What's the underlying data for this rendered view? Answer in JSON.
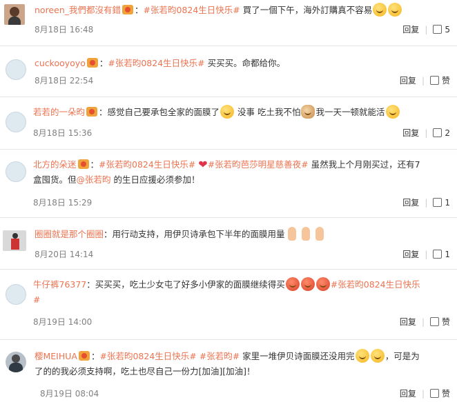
{
  "comments": [
    {
      "user": "noreen_我們都沒有錯",
      "topic": "#张若昀0824生日快乐#",
      "text": " 買了一個下午，海外訂購真不容易",
      "time": "8月18日 16:48",
      "reply": "回复",
      "likes": "5"
    },
    {
      "user": "cuckooyoyo",
      "topic": "#张若昀0824生日快乐#",
      "text": " 买买买。命都给你。",
      "time": "8月18日 22:54",
      "reply": "回复",
      "likes": "赞"
    },
    {
      "user": "若若的一朵昀",
      "text1": "：感觉自己要承包全家的面膜了",
      "text2": " 没事 吃土我不怕",
      "text3": "我一天一顿就能活",
      "time": "8月18日 15:36",
      "reply": "回复",
      "likes": "2"
    },
    {
      "user": "北方的朵迷",
      "topic": "#张若昀0824生日快乐#",
      "topic2": "#张若昀芭莎明星慈善夜#",
      "text1": " 虽然我上个月刚买过，还有7",
      "text2": "盒囤货。但",
      "mention": "@张若昀",
      "text3": " 的生日应援必须参加！",
      "time": "8月18日 15:29",
      "reply": "回复",
      "likes": "1"
    },
    {
      "user": "圈圈就是那个圈圈",
      "text": "：用行动支持，用伊贝诗承包下半年的面膜用量",
      "time": "8月20日 14:14",
      "reply": "回复",
      "likes": "1"
    },
    {
      "user": "牛仔裤76377",
      "text": "：买买买，吃土少女屯了好多小伊家的面膜继续得买",
      "topic": "#张若昀0824生日快乐",
      "topic_end": "#",
      "time": "8月19日 14:00",
      "reply": "回复",
      "likes": "赞"
    },
    {
      "user": "樱MEIHUA",
      "topic": "#张若昀0824生日快乐#",
      "topic2": "#张若昀#",
      "text1": " 家里一堆伊贝诗面膜还没用完",
      "text2": "，可是为",
      "text3": "了的的我必须支持啊，吃土也尽自己一份力[加油][加油]！",
      "time": "8月19日 08:04",
      "reply": "回复",
      "likes": "赞"
    }
  ]
}
